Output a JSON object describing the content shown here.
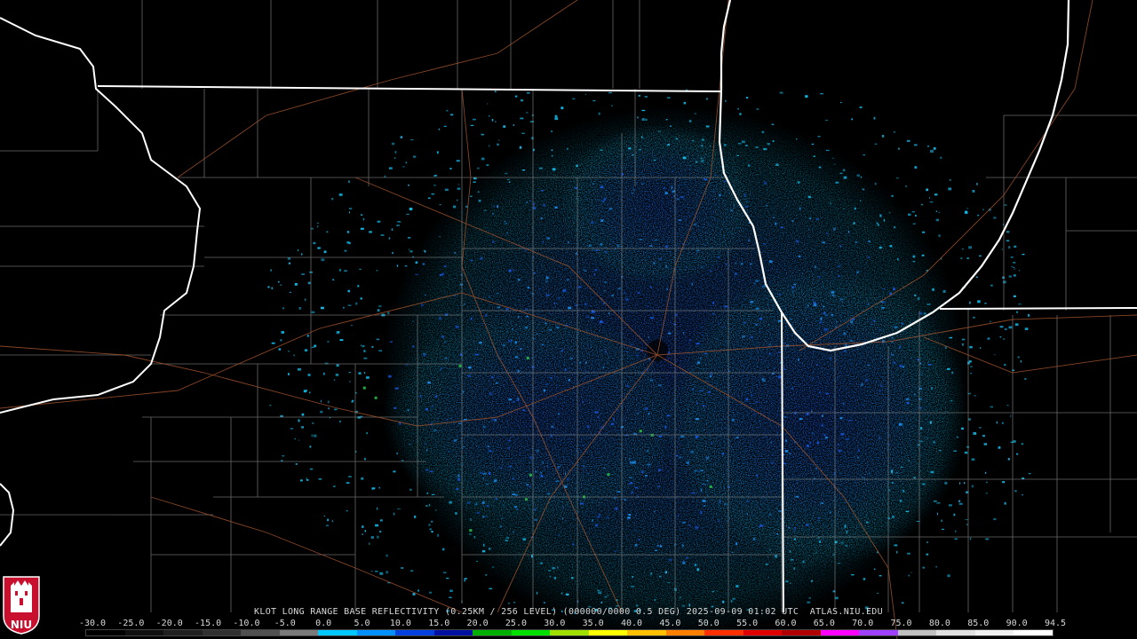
{
  "radar": {
    "caption": "KLOT LONG RANGE BASE REFLECTIVITY (0.25KM / 256 LEVEL) (000000/0000 0.5 DEG) 2025-09-09 01:02 UTC  ATLAS.NIU.EDU"
  },
  "scale": {
    "labels": [
      "-30.0",
      "-25.0",
      "-20.0",
      "-15.0",
      "-10.0",
      "-5.0",
      "0.0",
      "5.0",
      "10.0",
      "15.0",
      "20.0",
      "25.0",
      "30.0",
      "35.0",
      "40.0",
      "45.0",
      "50.0",
      "55.0",
      "60.0",
      "65.0",
      "70.0",
      "75.0",
      "80.0",
      "85.0",
      "90.0",
      "94.5"
    ],
    "colors": [
      "#000000",
      "#101010",
      "#202020",
      "#303030",
      "#505050",
      "#7a7a7a",
      "#00c8ff",
      "#0090ff",
      "#0040e0",
      "#0010a0",
      "#00b000",
      "#00e000",
      "#a0e000",
      "#ffff00",
      "#ffc000",
      "#ff8000",
      "#ff3000",
      "#e00000",
      "#b00000",
      "#ff00ff",
      "#a040ff",
      "#c0c0c0",
      "#e0e0e0",
      "#f0f0f0",
      "#ffffff"
    ]
  },
  "logo": {
    "text": "NIU",
    "color": "#c8102e"
  },
  "echo_colors": {
    "light": "#13b6e3",
    "medium": "#1a8ae8",
    "strong": "#1655e0",
    "green": "#22aa44"
  }
}
